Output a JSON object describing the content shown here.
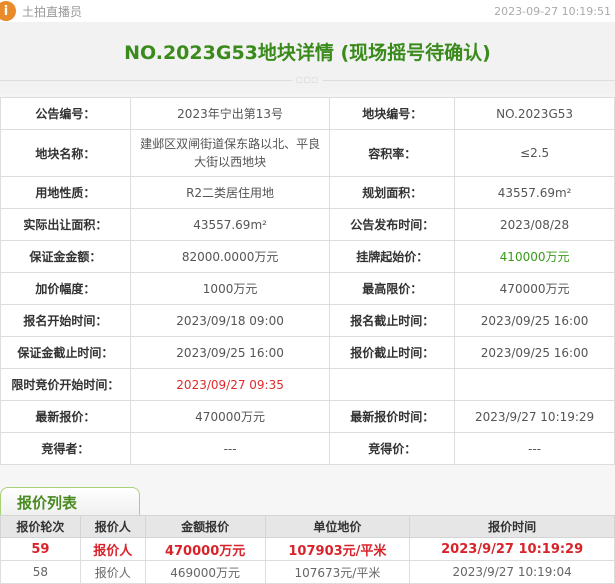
{
  "header": {
    "app_name": "土拍直播员",
    "logo_glyph": "i",
    "timestamp": "2023-09-27 10:19:51"
  },
  "title": "NO.2023G53地块详情 (现场摇号待确认)",
  "divider_glyph": "□□□",
  "info_rows": [
    [
      {
        "label": "公告编号：",
        "value": "2023年宁出第13号"
      },
      {
        "label": "地块编号：",
        "value": "NO.2023G53"
      }
    ],
    [
      {
        "label": "地块名称：",
        "value": "建邺区双闸街道保东路以北、平良大街以西地块"
      },
      {
        "label": "容积率：",
        "value": "≤2.5"
      }
    ],
    [
      {
        "label": "用地性质：",
        "value": "R2二类居住用地"
      },
      {
        "label": "规划面积：",
        "value": "43557.69m²"
      }
    ],
    [
      {
        "label": "实际出让面积：",
        "value": "43557.69m²"
      },
      {
        "label": "公告发布时间：",
        "value": "2023/08/28"
      }
    ],
    [
      {
        "label": "保证金金额：",
        "value": "82000.0000万元"
      },
      {
        "label": "挂牌起始价：",
        "value": "410000万元"
      }
    ],
    [
      {
        "label": "加价幅度：",
        "value": "1000万元"
      },
      {
        "label": "最高限价：",
        "value": "470000万元"
      }
    ],
    [
      {
        "label": "报名开始时间：",
        "value": "2023/09/18 09:00"
      },
      {
        "label": "报名截止时间：",
        "value": "2023/09/25 16:00"
      }
    ],
    [
      {
        "label": "保证金截止时间：",
        "value": "2023/09/25 16:00"
      },
      {
        "label": "报价截止时间：",
        "value": "2023/09/25 16:00"
      }
    ],
    [
      {
        "label": "限时竞价开始时间：",
        "value": "2023/09/27 09:35"
      },
      {
        "label": "",
        "value": ""
      }
    ],
    [
      {
        "label": "最新报价：",
        "value": "470000万元"
      },
      {
        "label": "最新报价时间：",
        "value": "2023/9/27 10:19:29"
      }
    ],
    [
      {
        "label": "竞得者：",
        "value": "---"
      },
      {
        "label": "竞得价：",
        "value": "---"
      }
    ]
  ],
  "bid_list": {
    "tab_label": "报价列表",
    "columns": [
      "报价轮次",
      "报价人",
      "金额报价",
      "单位地价",
      "报价时间"
    ],
    "rows": [
      [
        "59",
        "报价人",
        "470000万元",
        "107903元/平米",
        "2023/9/27 10:19:29"
      ],
      [
        "58",
        "报价人",
        "469000万元",
        "107673元/平米",
        "2023/9/27 10:19:04"
      ]
    ]
  },
  "colors": {
    "accent_green": "#3a8a1c",
    "highlight_red": "#d8232a"
  }
}
